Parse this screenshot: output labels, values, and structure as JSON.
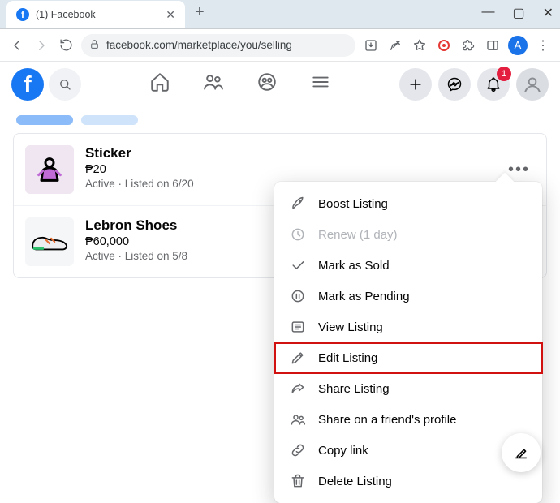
{
  "browser": {
    "tab_title": "(1) Facebook",
    "url": "facebook.com/marketplace/you/selling",
    "avatar_letter": "A"
  },
  "fb": {
    "logo_letter": "f",
    "notif_badge": "1"
  },
  "listings": [
    {
      "title": "Sticker",
      "price": "₱20",
      "meta": "Active · Listed on 6/20"
    },
    {
      "title": "Lebron Shoes",
      "price": "₱60,000",
      "meta": "Active · Listed on 5/8"
    }
  ],
  "menu": {
    "boost": "Boost Listing",
    "renew": "Renew (1 day)",
    "sold": "Mark as Sold",
    "pending": "Mark as Pending",
    "view": "View Listing",
    "edit": "Edit Listing",
    "share": "Share Listing",
    "share_friend": "Share on a friend's profile",
    "copy": "Copy link",
    "delete": "Delete Listing"
  }
}
